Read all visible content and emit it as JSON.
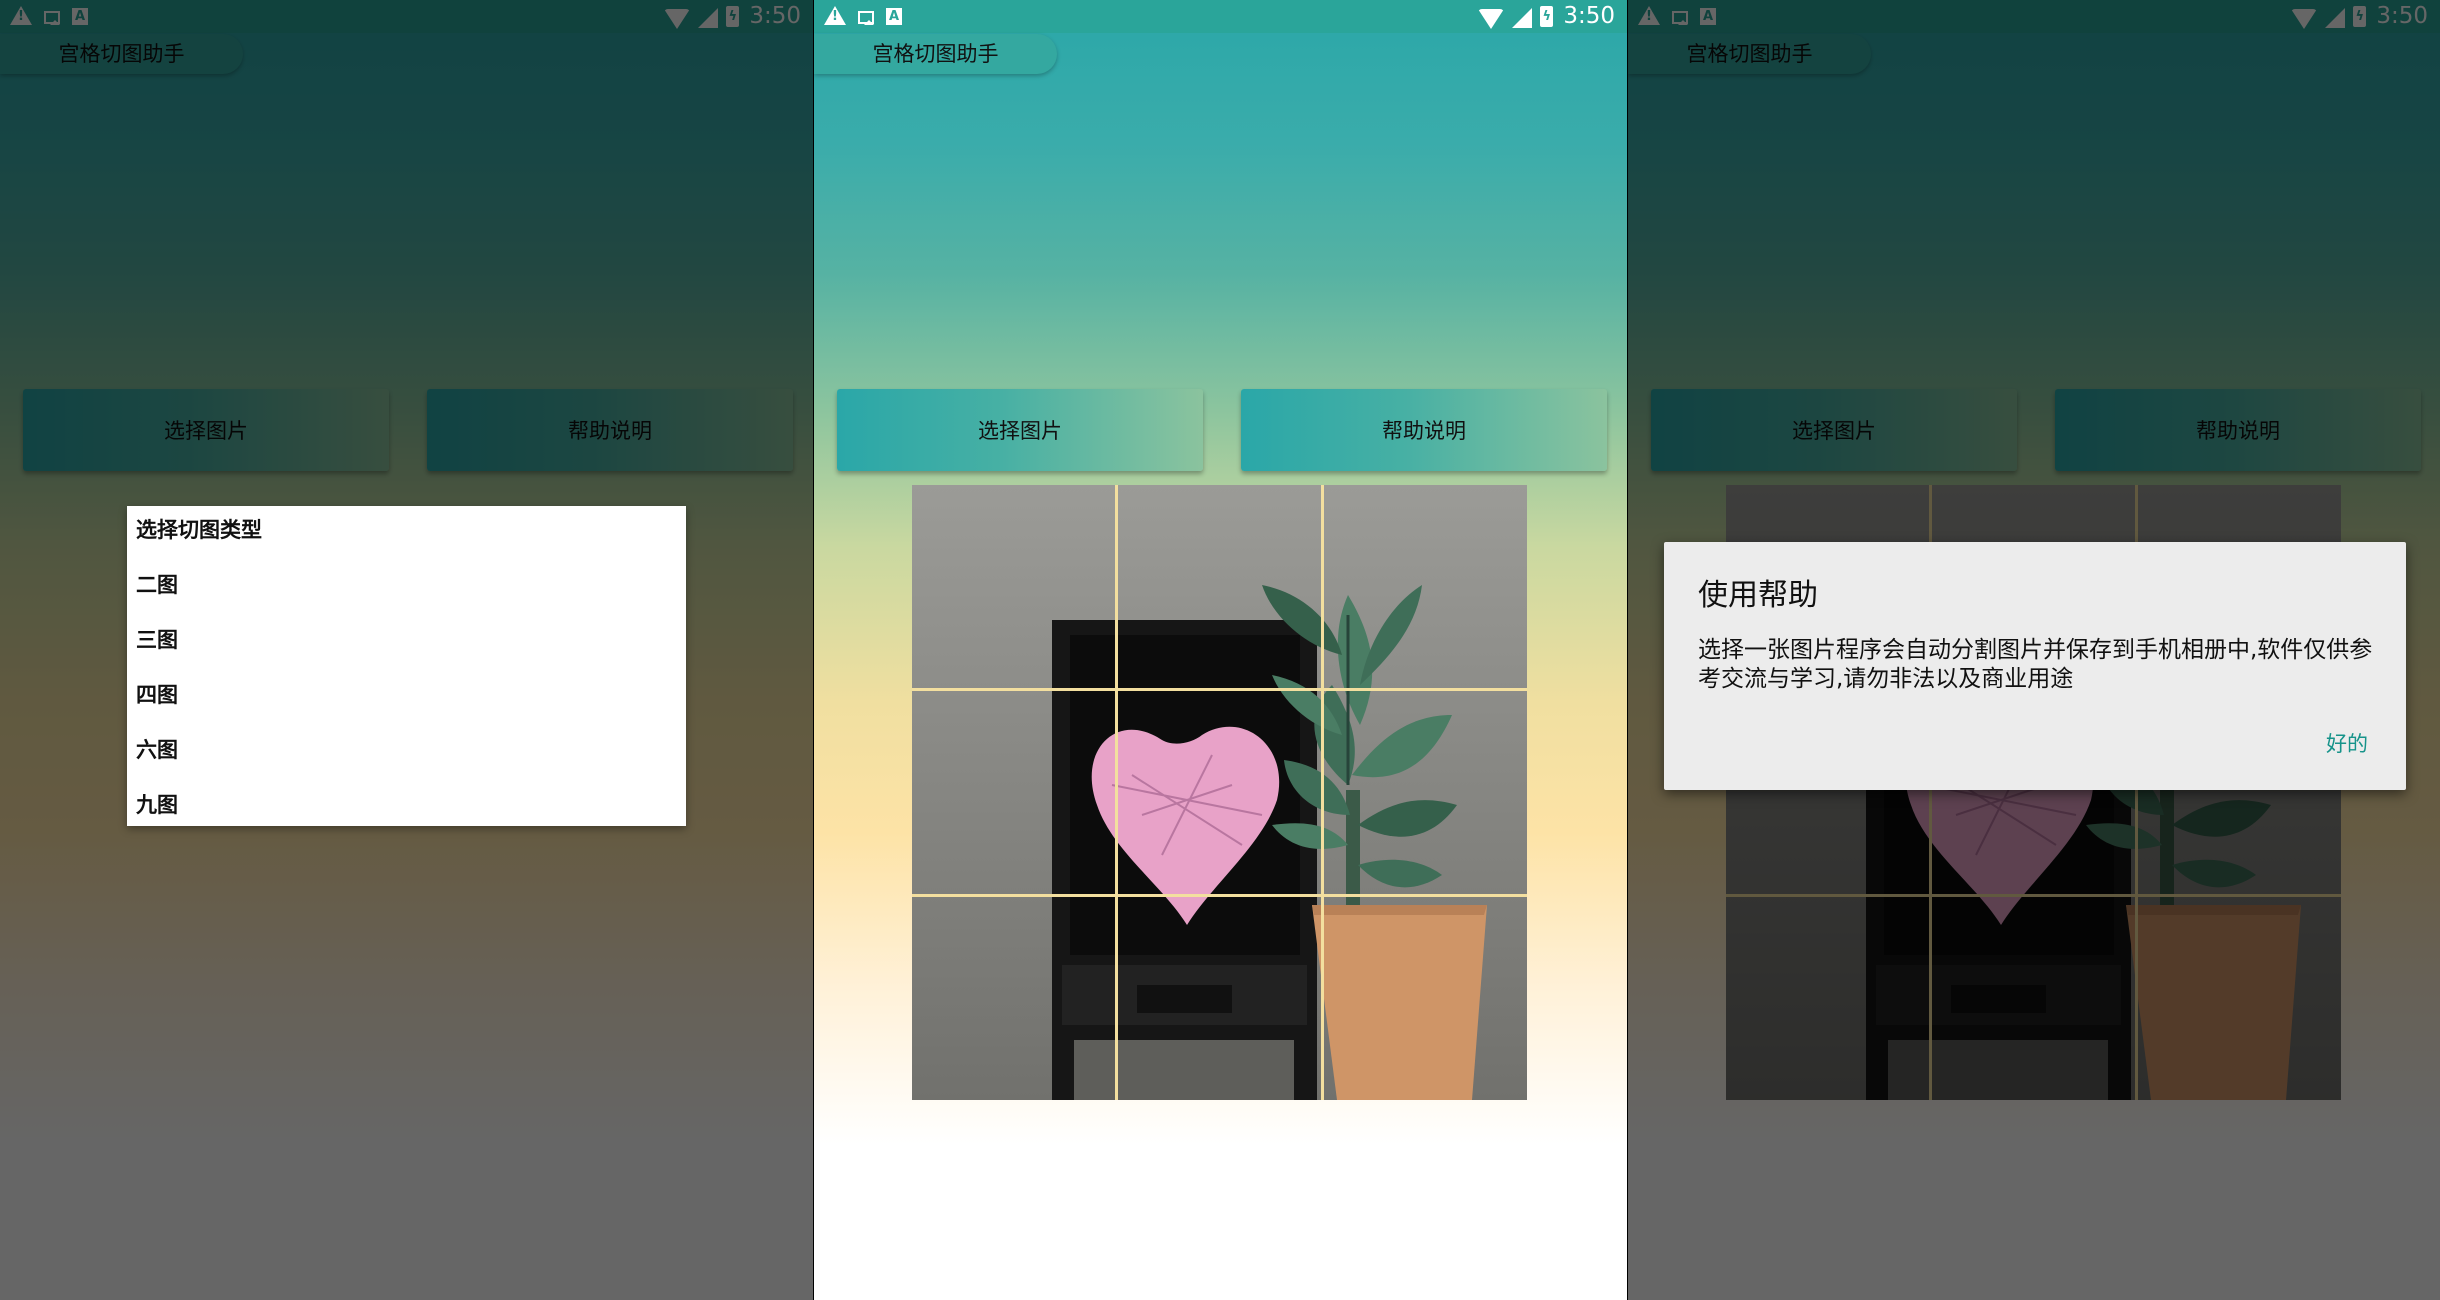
{
  "status_bar": {
    "time": "3:50"
  },
  "app": {
    "title": "宫格切图助手"
  },
  "buttons": {
    "select_image": "选择图片",
    "help": "帮助说明"
  },
  "colors": {
    "accent": "#2aa7a8",
    "grid_line": "#f3df9f",
    "dialog_button": "#16938a"
  },
  "screens": [
    {
      "name": "type-menu"
    },
    {
      "name": "main-grid"
    },
    {
      "name": "help-dialog"
    }
  ],
  "menu": {
    "title": "选择切图类型",
    "items": [
      "二图",
      "三图",
      "四图",
      "六图",
      "九图"
    ]
  },
  "grid": {
    "rows": 3,
    "cols": 3
  },
  "dialog": {
    "title": "使用帮助",
    "message": "选择一张图片程序会自动分割图片并保存到手机相册中,软件仅供参考交流与学习,请勿非法以及商业用途",
    "ok": "好的"
  }
}
